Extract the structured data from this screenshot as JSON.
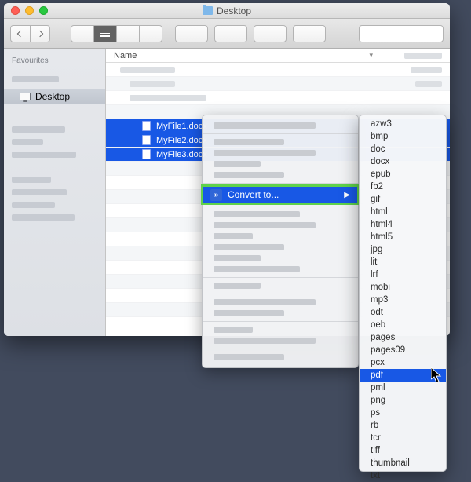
{
  "window": {
    "title": "Desktop"
  },
  "toolbar": {
    "back": "‹",
    "forward": "›"
  },
  "sidebar": {
    "section": "Favourites",
    "items": [
      {
        "label": "Desktop",
        "selected": true
      }
    ]
  },
  "columns": {
    "name": "Name"
  },
  "files": [
    {
      "name": "MyFile1.docx"
    },
    {
      "name": "MyFile2.docx"
    },
    {
      "name": "MyFile3.docx"
    }
  ],
  "context_menu": {
    "highlighted": {
      "label": "Convert to..."
    }
  },
  "submenu": {
    "highlighted": "pdf",
    "items": [
      "azw3",
      "bmp",
      "doc",
      "docx",
      "epub",
      "fb2",
      "gif",
      "html",
      "html4",
      "html5",
      "jpg",
      "lit",
      "lrf",
      "mobi",
      "mp3",
      "odt",
      "oeb",
      "pages",
      "pages09",
      "pcx",
      "pdf",
      "pml",
      "png",
      "ps",
      "rb",
      "tcr",
      "tiff",
      "thumbnail",
      "txt"
    ]
  }
}
